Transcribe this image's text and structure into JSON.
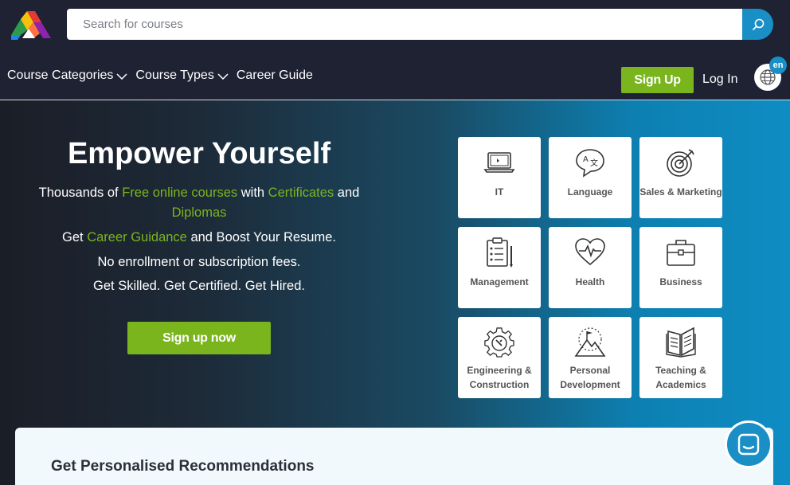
{
  "header": {
    "logo": "alison-logo",
    "search": {
      "placeholder": "Search for courses",
      "value": ""
    },
    "nav": [
      {
        "label": "Course Categories",
        "has_dropdown": true
      },
      {
        "label": "Course Types",
        "has_dropdown": true
      },
      {
        "label": "Career Guide",
        "has_dropdown": false
      }
    ],
    "signup_label": "Sign Up",
    "login_label": "Log In",
    "language_code": "en"
  },
  "hero": {
    "title": "Empower Yourself",
    "line1": {
      "a": "Thousands of ",
      "b": "Free online courses",
      "c": " with ",
      "d": "Certificates",
      "e": " and ",
      "f": "Diplomas"
    },
    "line2": {
      "a": "Get ",
      "b": "Career Guidance",
      "c": " and Boost Your Resume."
    },
    "line3": "No enrollment or subscription fees.",
    "line4": "Get Skilled. Get Certified. Get Hired.",
    "cta_label": "Sign up now"
  },
  "categories": [
    {
      "label": "IT",
      "icon": "laptop-icon"
    },
    {
      "label": "Language",
      "icon": "speech-bubble-icon"
    },
    {
      "label": "Sales & Marketing",
      "icon": "target-icon"
    },
    {
      "label": "Management",
      "icon": "clipboard-icon"
    },
    {
      "label": "Health",
      "icon": "heart-pulse-icon"
    },
    {
      "label": "Business",
      "icon": "briefcase-icon"
    },
    {
      "label": "Engineering & Construction",
      "line1": "Engineering &",
      "line2": "Construction",
      "icon": "gear-icon"
    },
    {
      "label": "Personal Development",
      "line1": "Personal",
      "line2": "Development",
      "icon": "mountain-flag-icon"
    },
    {
      "label": "Teaching & Academics",
      "line1": "Teaching &",
      "line2": "Academics",
      "icon": "book-icon"
    }
  ],
  "recommendations": {
    "title": "Get Personalised Recommendations"
  },
  "colors": {
    "accent_green": "#7ab51d",
    "accent_blue": "#1a8fc6",
    "header_bg": "#1e2233"
  }
}
